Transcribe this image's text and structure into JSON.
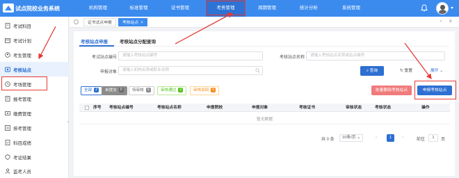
{
  "app": {
    "title": "试点院校业务系统"
  },
  "nav": [
    {
      "label": "机构管理"
    },
    {
      "label": "标准管理"
    },
    {
      "label": "证书管理"
    },
    {
      "label": "考务管理"
    },
    {
      "label": "周期管理"
    },
    {
      "label": "统计分析"
    },
    {
      "label": "系统管理"
    }
  ],
  "sidebar": [
    {
      "label": "考试科目",
      "icon": "book-icon"
    },
    {
      "label": "考试计划",
      "icon": "calendar-icon"
    },
    {
      "label": "考生管理",
      "icon": "user-icon"
    },
    {
      "label": "考核站点",
      "icon": "site-icon"
    },
    {
      "label": "考场管理",
      "icon": "room-icon"
    },
    {
      "label": "报考管理",
      "icon": "form-icon"
    },
    {
      "label": "缴费管理",
      "icon": "money-icon"
    },
    {
      "label": "排考管理",
      "icon": "schedule-icon"
    },
    {
      "label": "科目成绩",
      "icon": "score-icon"
    },
    {
      "label": "考证结果",
      "icon": "result-icon"
    },
    {
      "label": "监考人员",
      "icon": "invigilator-icon"
    }
  ],
  "tabs": [
    {
      "label": "证书试点申报"
    },
    {
      "label": "考核站点",
      "close": "×"
    }
  ],
  "subtabs": [
    {
      "label": "考核站点申报"
    },
    {
      "label": "考核站点分配查询"
    }
  ],
  "filters": {
    "org_code": {
      "label": "考试站点编号",
      "placeholder": "请输入考核站点编号"
    },
    "site_name": {
      "label": "考核站点名称",
      "placeholder": "请输入考核站点名称或站点编号"
    },
    "applicant": {
      "label": "申报对象",
      "placeholder": "请输入机构名称或职业名称"
    }
  },
  "buttons": {
    "search": "查询",
    "reset": "重置",
    "expand": "展开",
    "batch_delete": "批量删除考核站点",
    "new_site": "申报考核站点"
  },
  "chips": [
    {
      "label": "全部",
      "count": "2",
      "color": "#2d6fd2"
    },
    {
      "label": "未提交",
      "count": "0",
      "color": "#8c8c8c"
    },
    {
      "label": "待审核",
      "count": "0",
      "color": "#8c8c8c"
    },
    {
      "label": "审核通过",
      "count": "2",
      "color": "#52c41a"
    },
    {
      "label": "审核驳回",
      "count": "0",
      "color": "#fa8c16"
    }
  ],
  "table": {
    "headers": [
      "序号",
      "考核站点编号",
      "考核站点名称",
      "申报院校",
      "申报对象",
      "考核证书",
      "审核状态",
      "考核状态",
      "操作"
    ],
    "empty_text": "暂无数据"
  },
  "pagination": {
    "total": "共 0 条",
    "page_size": "10条/页",
    "current_page": "1",
    "goto_prefix": "前往",
    "goto_value": "1",
    "goto_suffix": "页"
  },
  "colors": {
    "primary": "#3b8bef",
    "accent": "#2d6fd2",
    "danger": "#f07b7b",
    "annotation": "#e53935"
  }
}
